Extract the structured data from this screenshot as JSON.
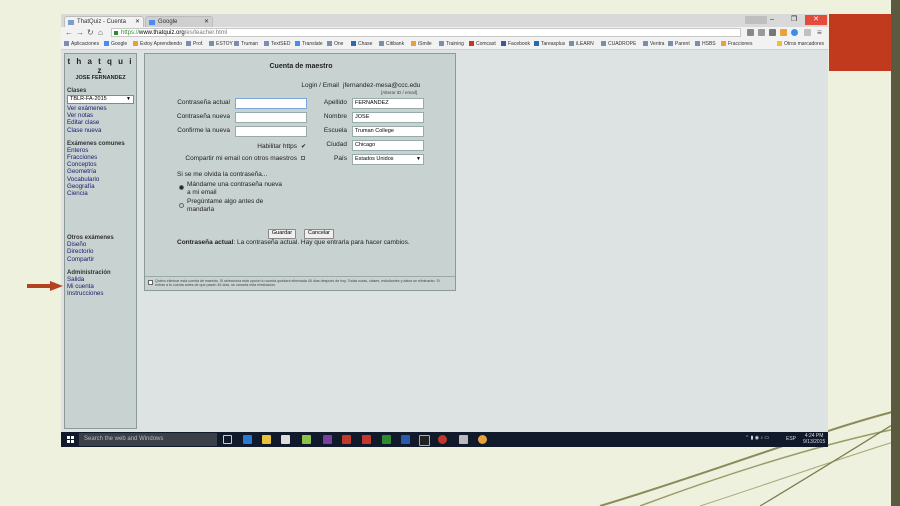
{
  "browser": {
    "tabs": [
      {
        "label": "ThatQuiz - Cuenta"
      },
      {
        "label": "Google"
      }
    ],
    "url": {
      "scheme": "https://",
      "domain": "www.thatquiz.org",
      "path": "/es/teacher.html"
    },
    "bookmarks": [
      "Aplicaciones",
      "Google",
      "Estoy Aprendiendo",
      "Prof.",
      "ESTOY",
      "Truman",
      "TextSED",
      "Translate",
      "One",
      "Chase",
      "Citibank",
      "iSmile",
      "Training",
      "Comcast",
      "Facebook",
      "Tareasplus",
      "iLEARN",
      "CUADROPE",
      "Ventra",
      "Parent",
      "HSBS",
      "Fracciones",
      "Otros marcadores"
    ]
  },
  "sidebar": {
    "logo": "t h a t q u i z",
    "user": "JOSE FERNANDEZ",
    "clases_title": "Clases",
    "class_select": "TBLR-FA-2015",
    "clases_items": [
      "Ver exámenes",
      "Ver notas",
      "Editar clase",
      "Clase nueva"
    ],
    "examenes_title": "Exámenes comunes",
    "examenes_items": [
      "Enteros",
      "Fracciones",
      "Conceptos",
      "Geometría",
      "Vocabulario",
      "Geografía",
      "Ciencia"
    ],
    "otros_title": "Otros exámenes",
    "otros_items": [
      "Diseño",
      "Directorio",
      "Compartir"
    ],
    "admin_title": "Administración",
    "admin_items": [
      "Salida",
      "Mi cuenta",
      "Instrucciones"
    ]
  },
  "account": {
    "title": "Cuenta de maestro",
    "login_label": "Login / Email",
    "login_value": "jfernandez-mesa@ccc.edu",
    "alter_link": "[Alterar ID / email]",
    "current_pw_label": "Contraseña actual",
    "new_pw_label": "Contraseña nueva",
    "confirm_pw_label": "Confirme la nueva",
    "https_label": "Habilitar https",
    "https_check": "✔",
    "share_email_label": "Compartir mi email con otros maestros",
    "apellido_label": "Apellido",
    "apellido_value": "FERNANDEZ",
    "nombre_label": "Nombre",
    "nombre_value": "JOSE",
    "escuela_label": "Escuela",
    "escuela_value": "Truman College",
    "ciudad_label": "Ciudad",
    "ciudad_value": "Chicago",
    "pais_label": "País",
    "pais_value": "Estados Unidos",
    "forgot_title": "Si se me olvida la contraseña...",
    "option1_line1": "Mándame una contraseña nueva",
    "option1_line2": "a mi email",
    "option2_line1": "Pregúntame algo antes de",
    "option2_line2": "mandarla",
    "save_button": "Guardar",
    "cancel_button": "Cancelar",
    "status_bold": "Contraseña actual",
    "status_text": ": La contraseña actual. Hay que entrarla para hacer cambios.",
    "footer_text": "Quiero eliminar esta cuenta de maestro. Si selecciona esta opción tu cuenta quedará eliminada 45 días después de hoy. Todas notas, clases, estudiantes y datos se eliminarán. Si entras a tu cuenta antes de que pasen 45 días, se cancela esta eliminación."
  },
  "taskbar": {
    "search_placeholder": "Search the web and Windows",
    "time": "4:24 PM",
    "date": "9/13/2015",
    "lang": "ESP"
  },
  "colors": {
    "slide_background": "#eef1de",
    "accent_red": "#c23a1e",
    "arrow": "#b5411e",
    "panel": "#c8d2d1"
  }
}
